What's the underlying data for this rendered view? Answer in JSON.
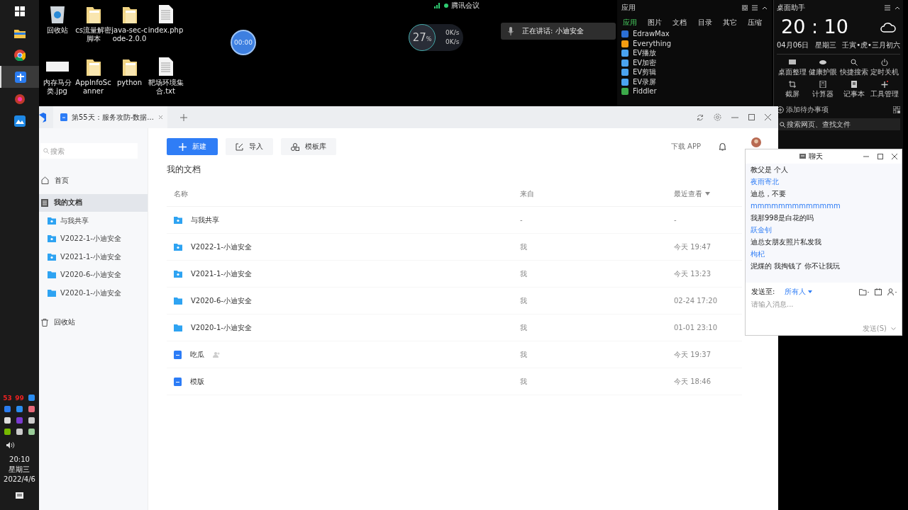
{
  "taskbar": {
    "apps": [
      {
        "kind": "windows",
        "selected": false
      },
      {
        "kind": "folder",
        "selected": false
      },
      {
        "kind": "chrome",
        "selected": false
      },
      {
        "kind": "cross",
        "selected": true
      },
      {
        "kind": "redapp",
        "selected": false
      },
      {
        "kind": "blueapp",
        "selected": false
      }
    ],
    "tray": [
      {
        "kind": "text",
        "text": "53"
      },
      {
        "kind": "text",
        "text": "99"
      },
      {
        "kind": "shield"
      },
      {
        "kind": "cross"
      },
      {
        "kind": "blueapp"
      },
      {
        "kind": "flower"
      },
      {
        "kind": "mic"
      },
      {
        "kind": "screen"
      },
      {
        "kind": "plane"
      },
      {
        "kind": "gpu"
      },
      {
        "kind": "network"
      },
      {
        "kind": "monitor"
      }
    ],
    "clock": {
      "time": "20:10",
      "weekday": "星期三",
      "date": "2022/4/6"
    }
  },
  "desktop_icons": [
    {
      "kind": "recycle",
      "label": "回收站"
    },
    {
      "kind": "folder",
      "label": "cs流量解密脚本"
    },
    {
      "kind": "folder",
      "label": "java-sec-code-2.0.0"
    },
    {
      "kind": "file",
      "label": "index.php"
    },
    {
      "kind": "image",
      "label": "内存马分类.jpg"
    },
    {
      "kind": "folder",
      "label": "AppInfoScanner"
    },
    {
      "kind": "folder",
      "label": "python"
    },
    {
      "kind": "file",
      "label": "靶场环境集合.txt"
    }
  ],
  "timer": "00:00",
  "meeting": {
    "title": "腾讯会议",
    "speaking": "正在讲话: 小迪安全"
  },
  "net_widget": {
    "percent": "27",
    "unit": "%",
    "up": "0K/s",
    "down": "0K/s"
  },
  "apps_panel": {
    "title": "应用",
    "tabs": [
      {
        "label": "应用",
        "selected": true
      },
      {
        "label": "图片",
        "selected": false
      },
      {
        "label": "文档",
        "selected": false
      },
      {
        "label": "目录",
        "selected": false
      },
      {
        "label": "其它",
        "selected": false
      },
      {
        "label": "压缩",
        "selected": false
      }
    ],
    "items": [
      {
        "kind": "edraw",
        "label": "EdrawMax"
      },
      {
        "kind": "everything",
        "label": "Everything"
      },
      {
        "kind": "ev",
        "label": "EV播放"
      },
      {
        "kind": "ev",
        "label": "EV加密"
      },
      {
        "kind": "ev",
        "label": "EV剪辑"
      },
      {
        "kind": "ev",
        "label": "EV录屏"
      },
      {
        "kind": "fiddler",
        "label": "Fiddler"
      }
    ]
  },
  "desk_helper": {
    "title": "桌面助手",
    "time": "20 : 10",
    "date": "04月06日",
    "weekday": "星期三",
    "lunar": "壬寅•虎•三月初六",
    "tools": [
      {
        "kind": "monitor",
        "label": "桌面整理"
      },
      {
        "kind": "eye",
        "label": "健康护眼"
      },
      {
        "kind": "search",
        "label": "快捷搜索"
      },
      {
        "kind": "power",
        "label": "定时关机"
      },
      {
        "kind": "crop",
        "label": "截屏"
      },
      {
        "kind": "calc",
        "label": "计算器"
      },
      {
        "kind": "note",
        "label": "记事本"
      },
      {
        "kind": "plus",
        "label": "工具管理"
      }
    ],
    "todo": "添加待办事项",
    "search_placeholder": "搜索网页、查找文件"
  },
  "doc_window": {
    "tab": "第55天：服务攻防-数据...",
    "search_placeholder": "搜索",
    "nav": [
      {
        "kind": "home",
        "label": "首页",
        "selected": false
      },
      {
        "kind": "docs",
        "label": "我的文档",
        "selected": true,
        "children": [
          {
            "kind": "shared",
            "label": "与我共享"
          },
          {
            "kind": "shared",
            "label": "V2022-1-小迪安全"
          },
          {
            "kind": "shared",
            "label": "V2021-1-小迪安全"
          },
          {
            "kind": "folder",
            "label": "V2020-6-小迪安全"
          },
          {
            "kind": "folder",
            "label": "V2020-1-小迪安全"
          }
        ]
      },
      {
        "kind": "trash",
        "label": "回收站",
        "selected": false
      }
    ],
    "toolbar": [
      {
        "kind": "new",
        "label": "新建"
      },
      {
        "kind": "import",
        "label": "导入"
      },
      {
        "kind": "template",
        "label": "模板库"
      }
    ],
    "download": "下载 APP",
    "heading": "我的文档",
    "columns": [
      "名称",
      "来自",
      "最近查看"
    ],
    "rows": [
      {
        "kind": "shared",
        "name": "与我共享",
        "from": "-",
        "viewed": "-"
      },
      {
        "kind": "shared",
        "name": "V2022-1-小迪安全",
        "from": "我",
        "viewed": "今天 19:47"
      },
      {
        "kind": "shared",
        "name": "V2021-1-小迪安全",
        "from": "我",
        "viewed": "今天 13:23"
      },
      {
        "kind": "folder",
        "name": "V2020-6-小迪安全",
        "from": "我",
        "viewed": "02-24 17:20"
      },
      {
        "kind": "folder",
        "name": "V2020-1-小迪安全",
        "from": "我",
        "viewed": "01-01 23:10"
      },
      {
        "kind": "doc",
        "name": "吃瓜",
        "from": "我",
        "viewed": "今天 19:37",
        "collab": true
      },
      {
        "kind": "doc",
        "name": "模版",
        "from": "我",
        "viewed": "今天 18:46",
        "collab": false
      }
    ]
  },
  "chat": {
    "title": "聊天",
    "messages": [
      {
        "kind": "text",
        "text": "教父是 个人"
      },
      {
        "kind": "name",
        "text": "夜雨寄北"
      },
      {
        "kind": "text",
        "text": "迪总，不要"
      },
      {
        "kind": "name",
        "text": "mmmmmmmmmmmmm"
      },
      {
        "kind": "text",
        "text": "我那998是白花的吗"
      },
      {
        "kind": "name",
        "text": "跃金钊"
      },
      {
        "kind": "text",
        "text": "迪总女朋友照片私发我"
      },
      {
        "kind": "name",
        "text": "枸杞"
      },
      {
        "kind": "text",
        "text": "泥煤的 我掏钱了 你不让我玩"
      }
    ],
    "send_to_label": "发送至:",
    "recipient": "所有人",
    "placeholder": "请输入消息...",
    "send": "发送(S)"
  }
}
